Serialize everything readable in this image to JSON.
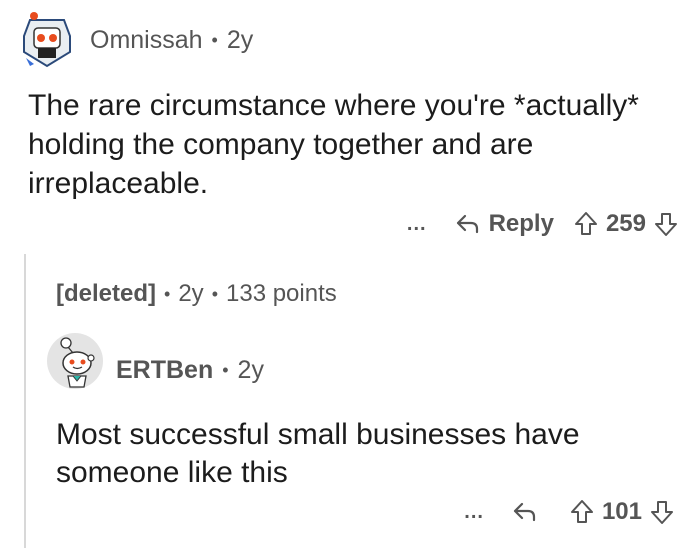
{
  "comments": [
    {
      "author": "Omnissah",
      "age": "2y",
      "body": "The rare circumstance where you're *actually* holding the company together and are irreplaceable.",
      "more": "...",
      "reply_label": "Reply",
      "score": "259"
    }
  ],
  "deleted_comment": {
    "author": "[deleted]",
    "age": "2y",
    "points": "133 points"
  },
  "reply_comment": {
    "author": "ERTBen",
    "age": "2y",
    "body": "Most successful small businesses have someone like this",
    "more": "...",
    "score": "101"
  },
  "colors": {
    "text": "#1c1c1c",
    "meta": "#555555",
    "thread_line": "#d8d8d8"
  }
}
